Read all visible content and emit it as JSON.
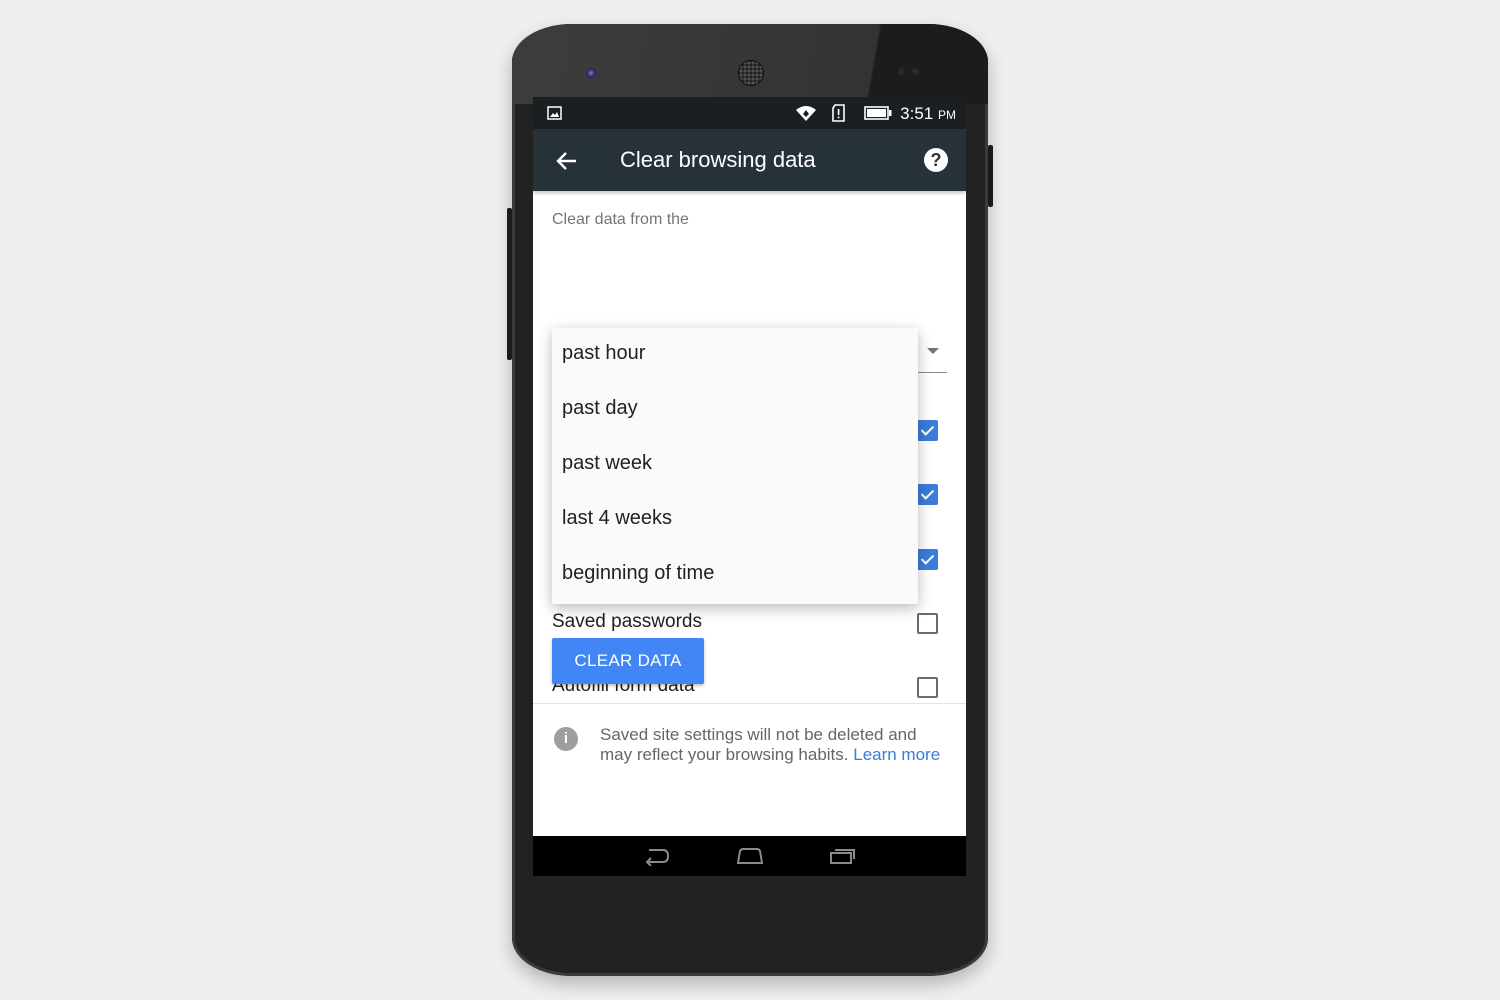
{
  "statusbar": {
    "notification_icon": "image-icon",
    "icons": [
      "wifi-icon",
      "sim-alert-icon",
      "battery-icon"
    ],
    "time": "3:51",
    "ampm": "PM"
  },
  "appbar": {
    "back_icon": "arrow-left-icon",
    "title": "Clear browsing data",
    "help_icon": "help-icon"
  },
  "range": {
    "label": "Clear data from the",
    "options": [
      "past hour",
      "past day",
      "past week",
      "last 4 weeks",
      "beginning of time"
    ]
  },
  "hidden_rows": [
    {
      "checked": true
    },
    {
      "checked": true
    },
    {
      "checked": true
    }
  ],
  "rows": [
    {
      "label": "Saved passwords",
      "checked": false
    },
    {
      "label": "Autofill form data",
      "checked": false
    }
  ],
  "clear_button": "CLEAR DATA",
  "info": {
    "text": "Saved site settings will not be deleted and may reflect your browsing habits.",
    "link": "Learn more"
  },
  "nav": {
    "back": "back-icon",
    "home": "home-icon",
    "recents": "recents-icon"
  },
  "colors": {
    "accent": "#4285f4",
    "appbar": "#263238",
    "checkbox": "#3b7ddb"
  }
}
